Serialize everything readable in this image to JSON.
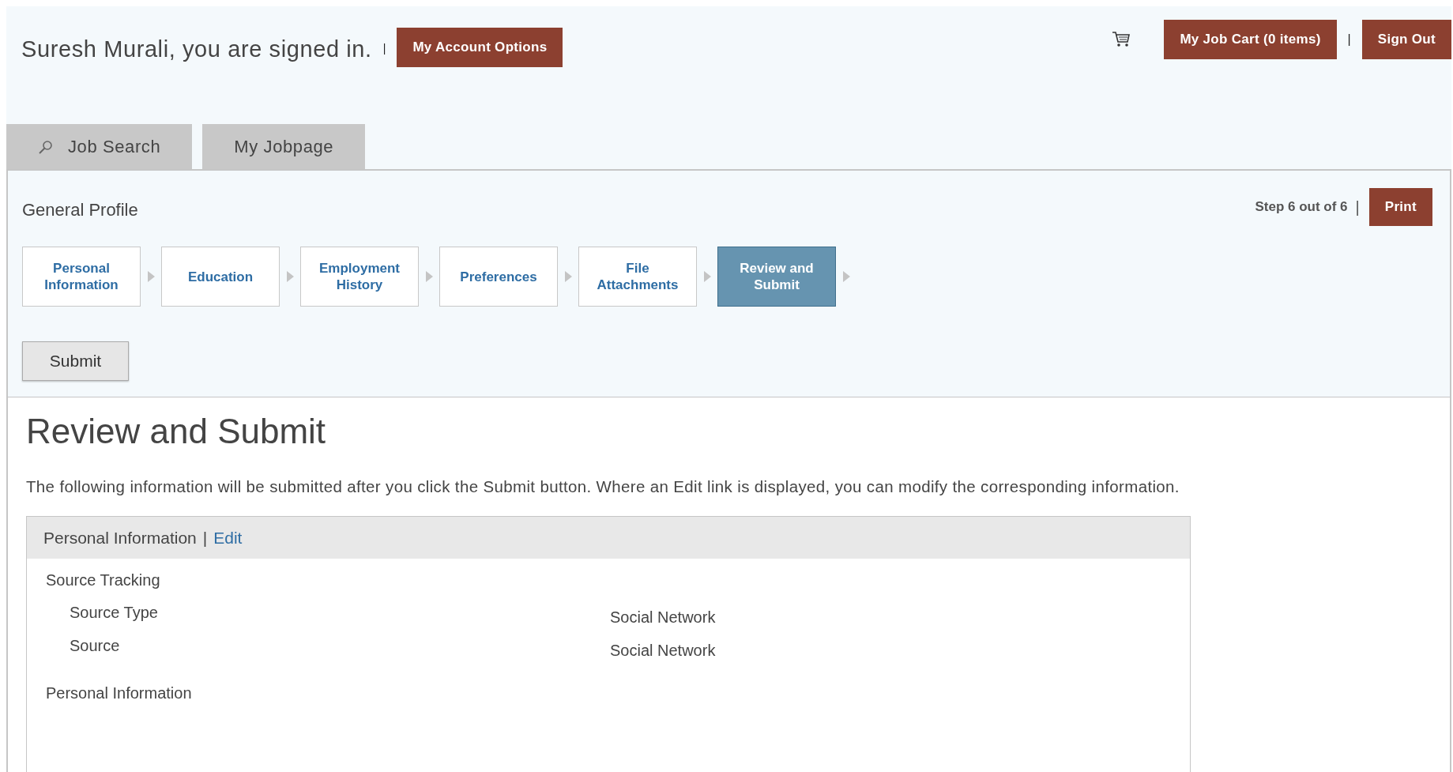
{
  "header": {
    "greeting": "Suresh Murali, you are signed in.",
    "greeting_divider": "|",
    "account_button": "My Account Options",
    "cart_button": "My Job Cart (0 items)",
    "cart_divider": "|",
    "sign_out_button": "Sign Out"
  },
  "tabs": [
    {
      "label": "Job Search",
      "kind": "search",
      "selected": false
    },
    {
      "label": "My Jobpage",
      "kind": "plain",
      "selected": false
    }
  ],
  "profile": {
    "title": "General Profile",
    "step_text": "Step 6 out of 6",
    "step_divider": "|",
    "print_button": "Print",
    "submit_button": "Submit",
    "steps": [
      {
        "label": "Personal Information",
        "selected": false
      },
      {
        "label": "Education",
        "selected": false
      },
      {
        "label": "Employment History",
        "selected": false
      },
      {
        "label": "Preferences",
        "selected": false
      },
      {
        "label": "File Attachments",
        "selected": false
      },
      {
        "label": "Review and Submit",
        "selected": true
      }
    ]
  },
  "review": {
    "heading": "Review and Submit",
    "intro": "The following information will be submitted after you click the Submit button. Where an Edit link is displayed, you can modify the corresponding information.",
    "sections": [
      {
        "title": "Personal Information",
        "divider": "|",
        "edit_link": "Edit",
        "groups": [
          {
            "title": "Source Tracking",
            "rows": [
              {
                "label": "Source Type",
                "value": "Social Network"
              },
              {
                "label": "Source",
                "value": "Social Network"
              }
            ]
          },
          {
            "title": "Personal Information"
          }
        ]
      }
    ]
  }
}
